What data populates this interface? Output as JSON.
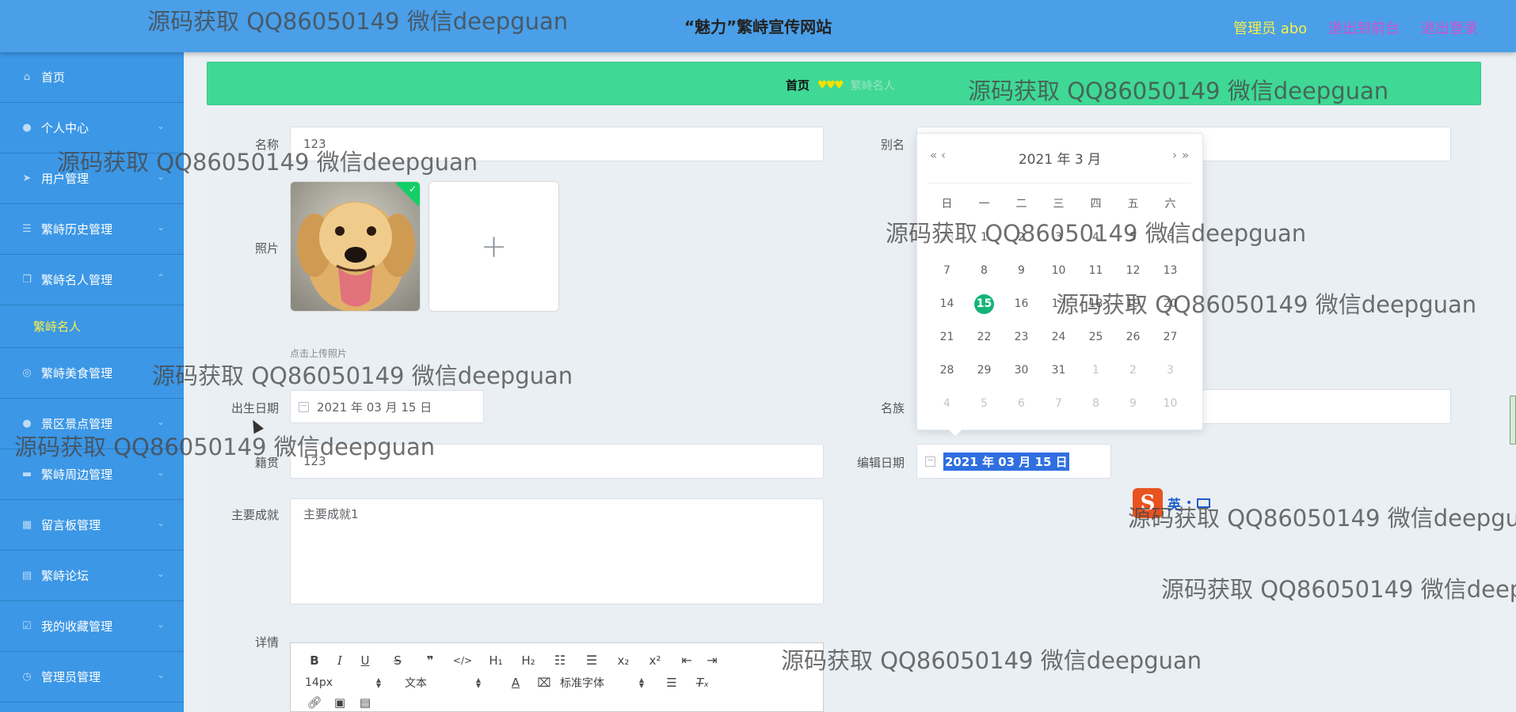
{
  "header": {
    "site_title": "“魅力”繁峙宣传网站",
    "admin_label": "管理员 abo",
    "front_label": "退出到前台",
    "logout_label": "退出登录",
    "colors": {
      "admin": "#f6f04a",
      "front": "#d24fd0",
      "logout": "#d24fd0"
    }
  },
  "sidebar": {
    "items": [
      {
        "label": "首页",
        "icon": "home-icon"
      },
      {
        "label": "个人中心",
        "icon": "person-icon"
      },
      {
        "label": "用户管理",
        "icon": "send-icon"
      },
      {
        "label": "繁峙历史管理",
        "icon": "list-icon"
      },
      {
        "label": "繁峙名人管理",
        "icon": "copy-icon"
      },
      {
        "label": "繁峙名人"
      },
      {
        "label": "繁峙美食管理",
        "icon": "compass-icon"
      },
      {
        "label": "景区景点管理",
        "icon": "person-icon"
      },
      {
        "label": "繁峙周边管理",
        "icon": "book-icon"
      },
      {
        "label": "留言板管理",
        "icon": "grid-icon"
      },
      {
        "label": "繁峙论坛",
        "icon": "clipboard-icon"
      },
      {
        "label": "我的收藏管理",
        "icon": "check-icon"
      },
      {
        "label": "管理员管理",
        "icon": "clock-icon"
      }
    ]
  },
  "breadcrumb": {
    "home": "首页",
    "separator": "♥♥♥",
    "current": "繁峙名人"
  },
  "form": {
    "name_label": "名称",
    "name_value": "123",
    "alias_label": "别名",
    "alias_value": "",
    "photo_label": "照片",
    "upload_hint": "点击上传照片",
    "birth_label": "出生日期",
    "birth_value": "2021 年 03 月 15 日",
    "ethnic_label": "名族",
    "ethnic_value": "",
    "native_label": "籍贯",
    "native_value": "123",
    "edit_date_label": "编辑日期",
    "edit_date_value": "2021 年 03 月 15 日",
    "achievements_label": "主要成就",
    "achievements_value": "主要成就1",
    "details_label": "详情"
  },
  "editor": {
    "row1": [
      "B",
      "I",
      "U",
      "S",
      "❞",
      "</>",
      "H₁",
      "H₂",
      "ol",
      "ul",
      "x₂",
      "x²",
      "outdent",
      "indent"
    ],
    "font_size": "14px",
    "text_type": "文本",
    "font_family": "标准字体"
  },
  "datepicker": {
    "title": "2021 年  3 月",
    "prev_year": "«",
    "prev_month": "‹",
    "next_month": "›",
    "next_year": "»",
    "weekdays": [
      "日",
      "一",
      "二",
      "三",
      "四",
      "五",
      "六"
    ],
    "weeks": [
      [
        "28",
        "1",
        "2",
        "3",
        "4",
        "5",
        "6"
      ],
      [
        "7",
        "8",
        "9",
        "10",
        "11",
        "12",
        "13"
      ],
      [
        "14",
        "15",
        "16",
        "17",
        "18",
        "19",
        "20"
      ],
      [
        "21",
        "22",
        "23",
        "24",
        "25",
        "26",
        "27"
      ],
      [
        "28",
        "29",
        "30",
        "31",
        "1",
        "2",
        "3"
      ],
      [
        "4",
        "5",
        "6",
        "7",
        "8",
        "9",
        "10"
      ]
    ],
    "selected": "15",
    "accent": "#13b47a"
  },
  "ime": {
    "en": "英",
    "dot": "•"
  },
  "watermark": "源码获取 QQ86050149 微信deepguan"
}
